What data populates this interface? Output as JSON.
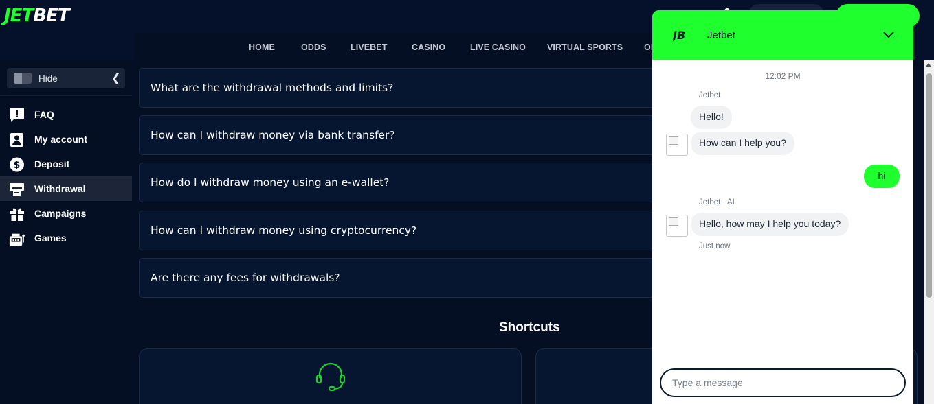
{
  "brand": {
    "logo_jet": "JET",
    "logo_bet": "BET"
  },
  "nav": {
    "items": [
      "HOME",
      "ODDS",
      "LIVEBET",
      "CASINO",
      "LIVE CASINO",
      "VIRTUAL SPORTS",
      "OF"
    ]
  },
  "sidebar": {
    "hide_label": "Hide",
    "items": [
      {
        "label": "FAQ",
        "icon": "faq-icon"
      },
      {
        "label": "My account",
        "icon": "account-icon"
      },
      {
        "label": "Deposit",
        "icon": "dollar-icon"
      },
      {
        "label": "Withdrawal",
        "icon": "withdrawal-icon",
        "active": true
      },
      {
        "label": "Campaigns",
        "icon": "gift-icon"
      },
      {
        "label": "Games",
        "icon": "casino-icon"
      }
    ]
  },
  "faq": {
    "questions": [
      "What are the withdrawal methods and limits?",
      "How can I withdraw money via bank transfer?",
      "How do I withdraw money using an e-wallet?",
      "How can I withdraw money using cryptocurrency?",
      "Are there any fees for withdrawals?"
    ]
  },
  "shortcuts": {
    "title": "Shortcuts"
  },
  "chat": {
    "title": "Jetbet",
    "logo_text": "JB",
    "time": "12:02 PM",
    "sender_1": "Jetbet",
    "msg_1": "Hello!",
    "msg_2": "How can I help you?",
    "user_msg": "hi",
    "sender_2": "Jetbet · AI",
    "msg_3": "Hello, how may I help you today?",
    "status": "Just now",
    "input_placeholder": "Type a message"
  },
  "colors": {
    "accent": "#1fff2e",
    "background": "#040f24",
    "card": "#061630"
  }
}
